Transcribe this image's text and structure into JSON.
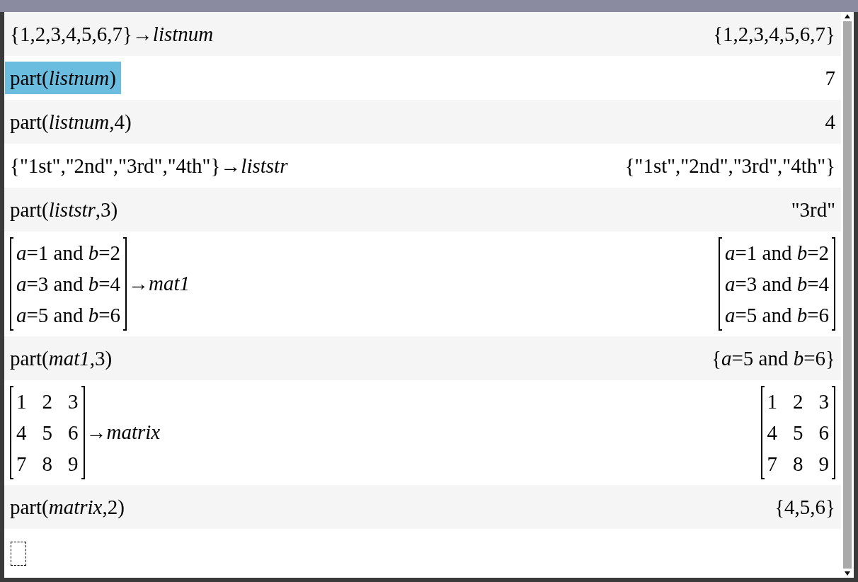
{
  "entries": [
    {
      "kind": "calc",
      "selected": false,
      "input": {
        "kind": "text",
        "text": "{1,2,3,4,5,6,7}→*listnum*"
      },
      "output": {
        "kind": "text",
        "text": "{1,2,3,4,5,6,7}"
      }
    },
    {
      "kind": "calc",
      "selected": true,
      "input": {
        "kind": "text",
        "text": "part(*listnum*)"
      },
      "output": {
        "kind": "text",
        "text": "7"
      }
    },
    {
      "kind": "calc",
      "selected": false,
      "input": {
        "kind": "text",
        "text": "part(*listnum*,4)"
      },
      "output": {
        "kind": "text",
        "text": "4"
      }
    },
    {
      "kind": "calc",
      "selected": false,
      "input": {
        "kind": "text",
        "text": "{\"1st\",\"2nd\",\"3rd\",\"4th\"}→*liststr*"
      },
      "output": {
        "kind": "text",
        "text": "{\"1st\",\"2nd\",\"3rd\",\"4th\"}"
      }
    },
    {
      "kind": "calc",
      "selected": false,
      "input": {
        "kind": "text",
        "text": "part(*liststr*,3)"
      },
      "output": {
        "kind": "text",
        "text": "\"3rd\""
      }
    },
    {
      "kind": "calc",
      "selected": false,
      "input": {
        "kind": "matrix",
        "rows": [
          [
            "*a*=1 and *b*=2"
          ],
          [
            "*a*=3 and *b*=4"
          ],
          [
            "*a*=5 and *b*=6"
          ]
        ],
        "assign": "→*mat1*"
      },
      "output": {
        "kind": "matrix",
        "rows": [
          [
            "*a*=1 and *b*=2"
          ],
          [
            "*a*=3 and *b*=4"
          ],
          [
            "*a*=5 and *b*=6"
          ]
        ]
      }
    },
    {
      "kind": "calc",
      "selected": false,
      "input": {
        "kind": "text",
        "text": "part(*mat1*,3)"
      },
      "output": {
        "kind": "text",
        "text": "{*a*=5 and *b*=6}"
      }
    },
    {
      "kind": "calc",
      "selected": false,
      "input": {
        "kind": "matrix",
        "rows": [
          [
            "1",
            "2",
            "3"
          ],
          [
            "4",
            "5",
            "6"
          ],
          [
            "7",
            "8",
            "9"
          ]
        ],
        "assign": "→*matrix*"
      },
      "output": {
        "kind": "matrix",
        "rows": [
          [
            "1",
            "2",
            "3"
          ],
          [
            "4",
            "5",
            "6"
          ],
          [
            "7",
            "8",
            "9"
          ]
        ]
      }
    },
    {
      "kind": "calc",
      "selected": false,
      "input": {
        "kind": "text",
        "text": "part(*matrix*,2)"
      },
      "output": {
        "kind": "text",
        "text": "{4,5,6}"
      }
    },
    {
      "kind": "empty",
      "selected": false
    }
  ]
}
